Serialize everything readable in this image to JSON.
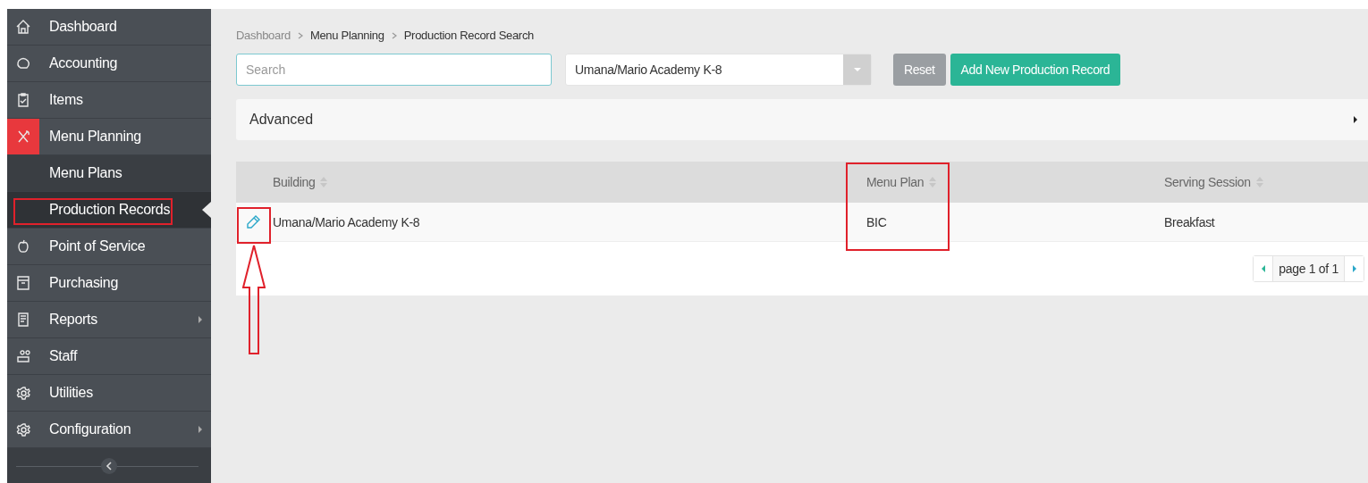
{
  "sidebar": {
    "items": [
      {
        "label": "Dashboard",
        "selected": false,
        "expandable": false
      },
      {
        "label": "Accounting",
        "selected": false,
        "expandable": false
      },
      {
        "label": "Items",
        "selected": false,
        "expandable": false
      },
      {
        "label": "Menu Planning",
        "selected": true,
        "expandable": false,
        "children": [
          {
            "label": "Menu Plans",
            "selected": false
          },
          {
            "label": "Production Records",
            "selected": true
          }
        ]
      },
      {
        "label": "Point of Service",
        "selected": false,
        "expandable": false
      },
      {
        "label": "Purchasing",
        "selected": false,
        "expandable": false
      },
      {
        "label": "Reports",
        "selected": false,
        "expandable": true
      },
      {
        "label": "Staff",
        "selected": false,
        "expandable": false
      },
      {
        "label": "Utilities",
        "selected": false,
        "expandable": false
      },
      {
        "label": "Configuration",
        "selected": false,
        "expandable": true
      }
    ]
  },
  "breadcrumb": [
    "Dashboard",
    "Menu Planning",
    "Production Record Search"
  ],
  "search": {
    "placeholder": "Search"
  },
  "building_select": {
    "value": "Umana/Mario Academy K-8"
  },
  "buttons": [
    {
      "label": "Reset",
      "kind": "secondary"
    },
    {
      "label": "Add New Production Record",
      "kind": "primary"
    }
  ],
  "advanced": {
    "title": "Advanced",
    "expanded": false
  },
  "table": {
    "columns": [
      "Building",
      "Menu Plan",
      "Serving Session"
    ],
    "rows": [
      {
        "building": "Umana/Mario Academy K-8",
        "menu_plan": "BIC",
        "serving_session": "Breakfast"
      }
    ]
  },
  "pager": {
    "text": "page 1 of 1"
  }
}
